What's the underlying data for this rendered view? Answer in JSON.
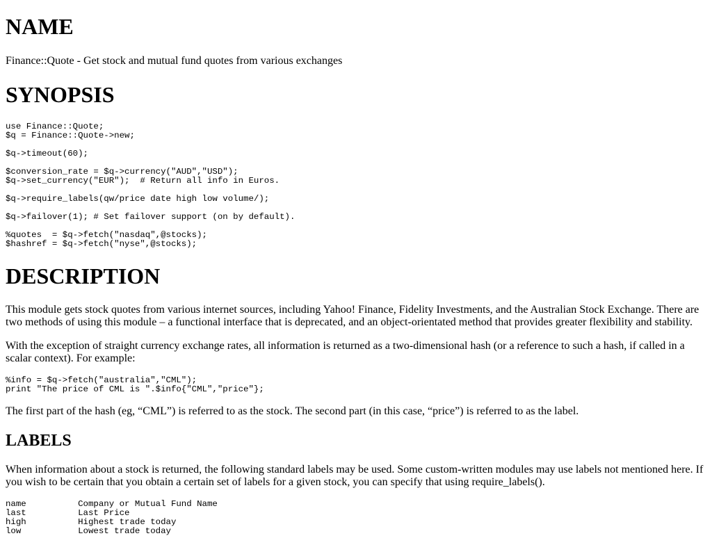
{
  "name": {
    "heading": "NAME",
    "text": "Finance::Quote - Get stock and mutual fund quotes from various exchanges"
  },
  "synopsis": {
    "heading": "SYNOPSIS",
    "code": [
      "use Finance::Quote;",
      "$q = Finance::Quote->new;",
      "",
      "$q->timeout(60);",
      "",
      "$conversion_rate = $q->currency(\"AUD\",\"USD\");",
      "$q->set_currency(\"EUR\");  # Return all info in Euros.",
      "",
      "$q->require_labels(qw/price date high low volume/);",
      "",
      "$q->failover(1); # Set failover support (on by default).",
      "",
      "%quotes  = $q->fetch(\"nasdaq\",@stocks);",
      "$hashref = $q->fetch(\"nyse\",@stocks);"
    ]
  },
  "description": {
    "heading": "DESCRIPTION",
    "para1": "This module gets stock quotes from various internet sources, including Yahoo! Finance, Fidelity Investments, and the Australian Stock Exchange. There are two methods of using this module – a functional interface that is deprecated, and an object-orientated method that provides greater flexibility and stability.",
    "para2": "With the exception of straight currency exchange rates, all information is returned as a two-dimensional hash (or a reference to such a hash, if called in a scalar context). For example:",
    "code": [
      "%info = $q->fetch(\"australia\",\"CML\");",
      "print \"The price of CML is \".$info{\"CML\",\"price\"};"
    ],
    "para3": "The first part of the hash (eg, “CML”) is referred to as the stock. The second part (in this case, “price”) is referred to as the label."
  },
  "labels": {
    "heading": "LABELS",
    "para": "When information about a stock is returned, the following standard labels may be used. Some custom-written modules may use labels not mentioned here. If you wish to be certain that you obtain a certain set of labels for a given stock, you can specify that using require_labels().",
    "code": [
      "name          Company or Mutual Fund Name",
      "last          Last Price",
      "high          Highest trade today",
      "low           Lowest trade today"
    ]
  }
}
